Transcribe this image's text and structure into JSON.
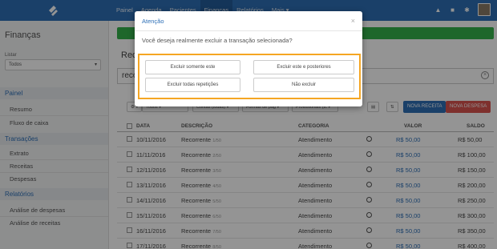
{
  "nav": {
    "items": [
      "Painel",
      "Agenda",
      "Pacientes",
      "Finanças",
      "Relatórios",
      "Mais ▾"
    ],
    "active_index": 3
  },
  "sidebar": {
    "title": "Finanças",
    "filter_label": "Listar",
    "filter_value": "Todos",
    "sections": [
      {
        "label": "Painel",
        "links": [
          "Resumo",
          "Fluxo de caixa"
        ]
      },
      {
        "label": "Transações",
        "links": [
          "Extrato",
          "Receitas",
          "Despesas"
        ]
      },
      {
        "label": "Relatórios",
        "links": [
          "Análise de despesas",
          "Análise de receitas"
        ]
      }
    ]
  },
  "main": {
    "title": "Rece",
    "search_value": "reco"
  },
  "toolbar": {
    "filters": [
      "Todos ▾",
      "Contas (todas) ▾",
      "Formas de pag ▾",
      "Profissionais (tc ▾"
    ],
    "new_income": "NOVA RECEITA",
    "new_expense": "NOVA DESPESA"
  },
  "table": {
    "headers": {
      "date": "DATA",
      "description": "DESCRIÇÃO",
      "category": "CATEGORIA",
      "value": "VALOR",
      "balance": "SALDO"
    },
    "rows": [
      {
        "date": "10/11/2016",
        "desc": "Recorrente",
        "sub": "1/50",
        "category": "Atendimento",
        "value": "R$ 50,00",
        "balance": "R$ 50,00"
      },
      {
        "date": "11/11/2016",
        "desc": "Recorrente",
        "sub": "2/50",
        "category": "Atendimento",
        "value": "R$ 50,00",
        "balance": "R$ 100,00"
      },
      {
        "date": "12/11/2016",
        "desc": "Recorrente",
        "sub": "3/50",
        "category": "Atendimento",
        "value": "R$ 50,00",
        "balance": "R$ 150,00"
      },
      {
        "date": "13/11/2016",
        "desc": "Recorrente",
        "sub": "4/50",
        "category": "Atendimento",
        "value": "R$ 50,00",
        "balance": "R$ 200,00"
      },
      {
        "date": "14/11/2016",
        "desc": "Recorrente",
        "sub": "5/50",
        "category": "Atendimento",
        "value": "R$ 50,00",
        "balance": "R$ 250,00"
      },
      {
        "date": "15/11/2016",
        "desc": "Recorrente",
        "sub": "6/50",
        "category": "Atendimento",
        "value": "R$ 50,00",
        "balance": "R$ 300,00"
      },
      {
        "date": "16/11/2016",
        "desc": "Recorrente",
        "sub": "7/50",
        "category": "Atendimento",
        "value": "R$ 50,00",
        "balance": "R$ 350,00"
      },
      {
        "date": "17/11/2016",
        "desc": "Recorrente",
        "sub": "8/50",
        "category": "Atendimento",
        "value": "R$ 50,00",
        "balance": "R$ 400,00"
      }
    ]
  },
  "modal": {
    "title": "Atenção",
    "close": "×",
    "question": "Você deseja realmente excluir a transação selecionada?",
    "buttons": {
      "only_this": "Excluir somente este",
      "this_and_next": "Excluir este e posteriores",
      "all_repeats": "Excluir todas repetições",
      "dont_delete": "Não excluir"
    }
  },
  "colors": {
    "brand_blue": "#2d6fb6",
    "success_green": "#35b14b",
    "danger_red": "#d9534f",
    "highlight_orange": "#f5a623"
  }
}
